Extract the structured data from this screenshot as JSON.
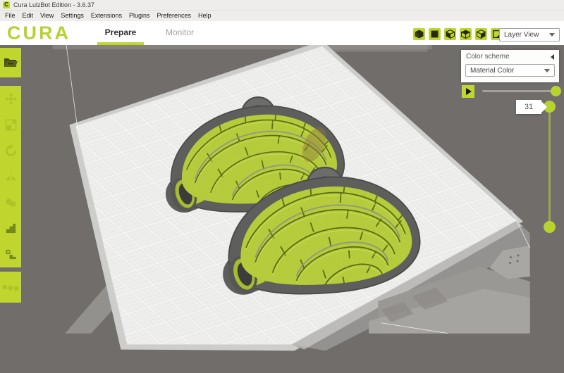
{
  "window": {
    "title": "Cura LulzBot Edition - 3.6.37",
    "app_icon": "C"
  },
  "menu_bar": {
    "items": [
      "File",
      "Edit",
      "View",
      "Settings",
      "Extensions",
      "Plugins",
      "Preferences",
      "Help"
    ]
  },
  "header": {
    "logo_text": "CURA",
    "tabs": [
      {
        "label": "Prepare",
        "active": true
      },
      {
        "label": "Monitor",
        "active": false
      }
    ],
    "camera_preset_icons": [
      "cube-3d-icon",
      "cube-front-icon",
      "cube-left-icon",
      "cube-top-icon",
      "cube-right-icon",
      "cube-page-icon"
    ],
    "view_mode_dropdown": {
      "value": "Layer View"
    }
  },
  "left_toolbar": {
    "open_file_icon": "open-folder-icon",
    "tool_icons": [
      "move-tool-icon",
      "scale-tool-icon",
      "rotate-tool-icon",
      "mirror-tool-icon",
      "per-model-settings-icon",
      "mesh-type-icon",
      "support-blocker-icon"
    ],
    "model_list_icon": "model-list-icon"
  },
  "layer_view_panel": {
    "title": "Color scheme",
    "color_scheme_dropdown": {
      "value": "Material Color"
    }
  },
  "simulation": {
    "play_button": "play-icon",
    "current_layer": "31"
  },
  "scene": {
    "description": "Two sliced igloo models shown in layer view on the build plate",
    "models": [
      {
        "name": "igloo-model-1"
      },
      {
        "name": "igloo-model-2"
      }
    ]
  },
  "colors": {
    "accent_green": "#bfd62f",
    "model_green": "#b2c938",
    "model_wall_gray": "#5e5e5c",
    "build_plate": "#ebebe9",
    "viewport_background": "#706d6a"
  }
}
